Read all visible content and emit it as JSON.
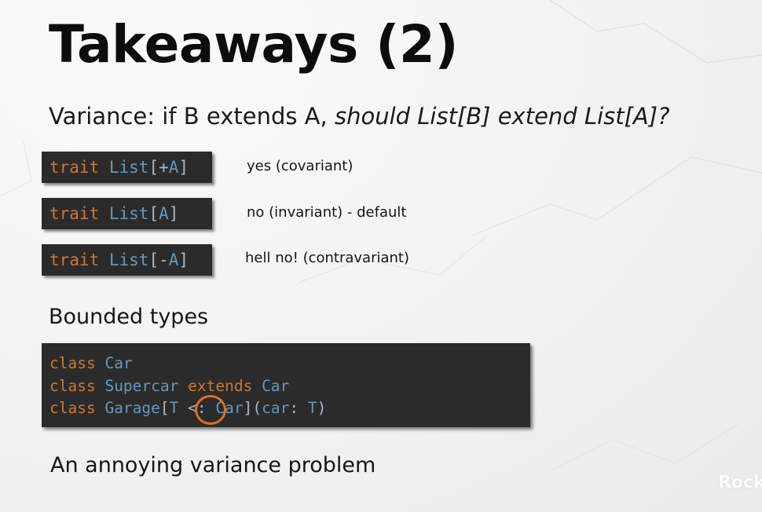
{
  "slide": {
    "title": "Takeaways (2)",
    "variance_question": {
      "prefix": "Variance: if B extends A, ",
      "emphasis": "should List[B] extend List[A]?"
    },
    "variance_cases": [
      {
        "code": {
          "keyword": "trait",
          "type": "List",
          "open": "[",
          "modifier": "+",
          "param": "A",
          "close": "]"
        },
        "description": "yes (covariant)"
      },
      {
        "code": {
          "keyword": "trait",
          "type": "List",
          "open": "[",
          "modifier": "",
          "param": "A",
          "close": "]"
        },
        "description": "no (invariant) - default"
      },
      {
        "code": {
          "keyword": "trait",
          "type": "List",
          "open": "[",
          "modifier": "-",
          "param": "A",
          "close": "]"
        },
        "description": "hell no! (contravariant)"
      }
    ],
    "bounded_types_heading": "Bounded types",
    "bounded_code": {
      "line1": {
        "kw": "class",
        "name": "Car"
      },
      "line2": {
        "kw": "class",
        "name": "Supercar",
        "kw2": "extends",
        "parent": "Car"
      },
      "line3": {
        "kw": "class",
        "name": "Garage",
        "open": "[",
        "tparam": "T",
        "bound": "<:",
        "upper": "Car",
        "close": "](",
        "arg": "car",
        "colon": ": ",
        "argtype": "T",
        "end": ")"
      }
    },
    "final_heading": "An annoying variance problem",
    "watermark": "Rock",
    "colors": {
      "keyword": "#cc7832",
      "type": "#6897bb",
      "plain": "#a9b7c6",
      "code_bg": "#2b2b2b",
      "highlight_ring": "#e07020"
    }
  }
}
